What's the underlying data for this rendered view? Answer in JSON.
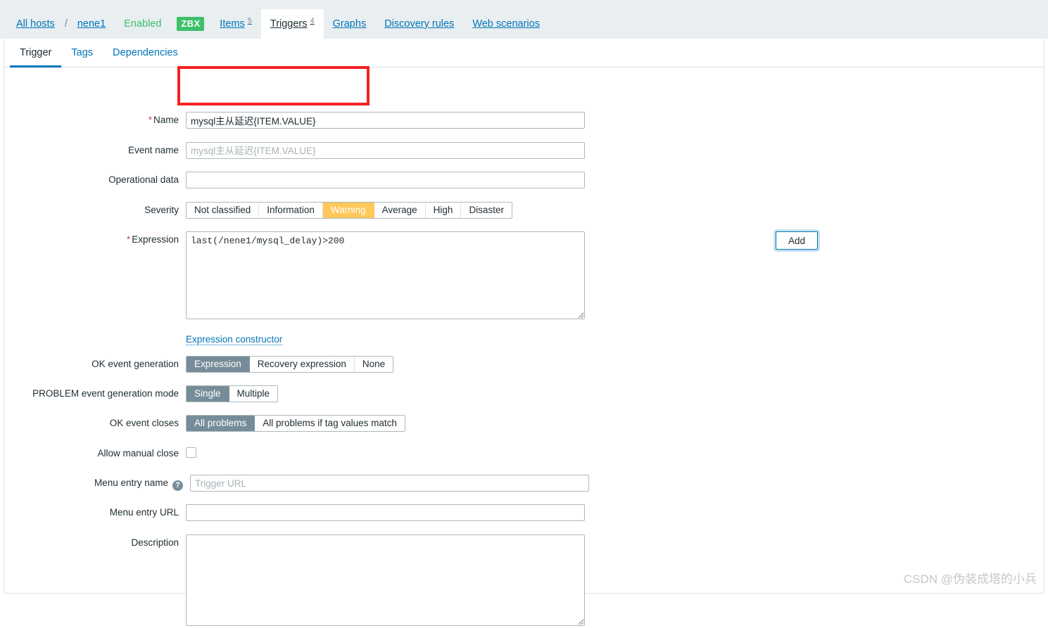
{
  "host_bar": {
    "all_hosts_label": "All hosts",
    "separator": "/",
    "host_name": "nene1",
    "status_label": "Enabled",
    "agent_badge": "ZBX",
    "tabs": [
      {
        "label": "Items",
        "count": "5",
        "active": false
      },
      {
        "label": "Triggers",
        "count": "4",
        "active": true
      },
      {
        "label": "Graphs",
        "count": "",
        "active": false
      },
      {
        "label": "Discovery rules",
        "count": "",
        "active": false
      },
      {
        "label": "Web scenarios",
        "count": "",
        "active": false
      }
    ]
  },
  "form_tabs": [
    {
      "label": "Trigger",
      "active": true
    },
    {
      "label": "Tags",
      "active": false
    },
    {
      "label": "Dependencies",
      "active": false
    }
  ],
  "form": {
    "name": {
      "label": "Name",
      "required": true,
      "value": "mysql主从延迟{ITEM.VALUE}",
      "placeholder": ""
    },
    "event_name": {
      "label": "Event name",
      "required": false,
      "value": "",
      "placeholder": "mysql主从延迟{ITEM.VALUE}"
    },
    "operational_data": {
      "label": "Operational data",
      "required": false,
      "value": "",
      "placeholder": ""
    },
    "severity": {
      "label": "Severity",
      "options": [
        "Not classified",
        "Information",
        "Warning",
        "Average",
        "High",
        "Disaster"
      ],
      "selected": "Warning"
    },
    "expression": {
      "label": "Expression",
      "required": true,
      "value": "last(/nene1/mysql_delay)>200",
      "add_button_label": "Add",
      "constructor_link": "Expression constructor"
    },
    "ok_event_generation": {
      "label": "OK event generation",
      "options": [
        "Expression",
        "Recovery expression",
        "None"
      ],
      "selected": "Expression"
    },
    "problem_event_generation_mode": {
      "label": "PROBLEM event generation mode",
      "options": [
        "Single",
        "Multiple"
      ],
      "selected": "Single"
    },
    "ok_event_closes": {
      "label": "OK event closes",
      "options": [
        "All problems",
        "All problems if tag values match"
      ],
      "selected": "All problems"
    },
    "allow_manual_close": {
      "label": "Allow manual close",
      "checked": false
    },
    "menu_entry_name": {
      "label": "Menu entry name",
      "help_icon": "?",
      "value": "",
      "placeholder": "Trigger URL"
    },
    "menu_entry_url": {
      "label": "Menu entry URL",
      "value": "",
      "placeholder": ""
    },
    "description": {
      "label": "Description",
      "value": "",
      "placeholder": ""
    }
  },
  "annotation": {
    "color": "#f52121"
  },
  "watermark": {
    "text": "CSDN @伪装成塔的小兵"
  }
}
